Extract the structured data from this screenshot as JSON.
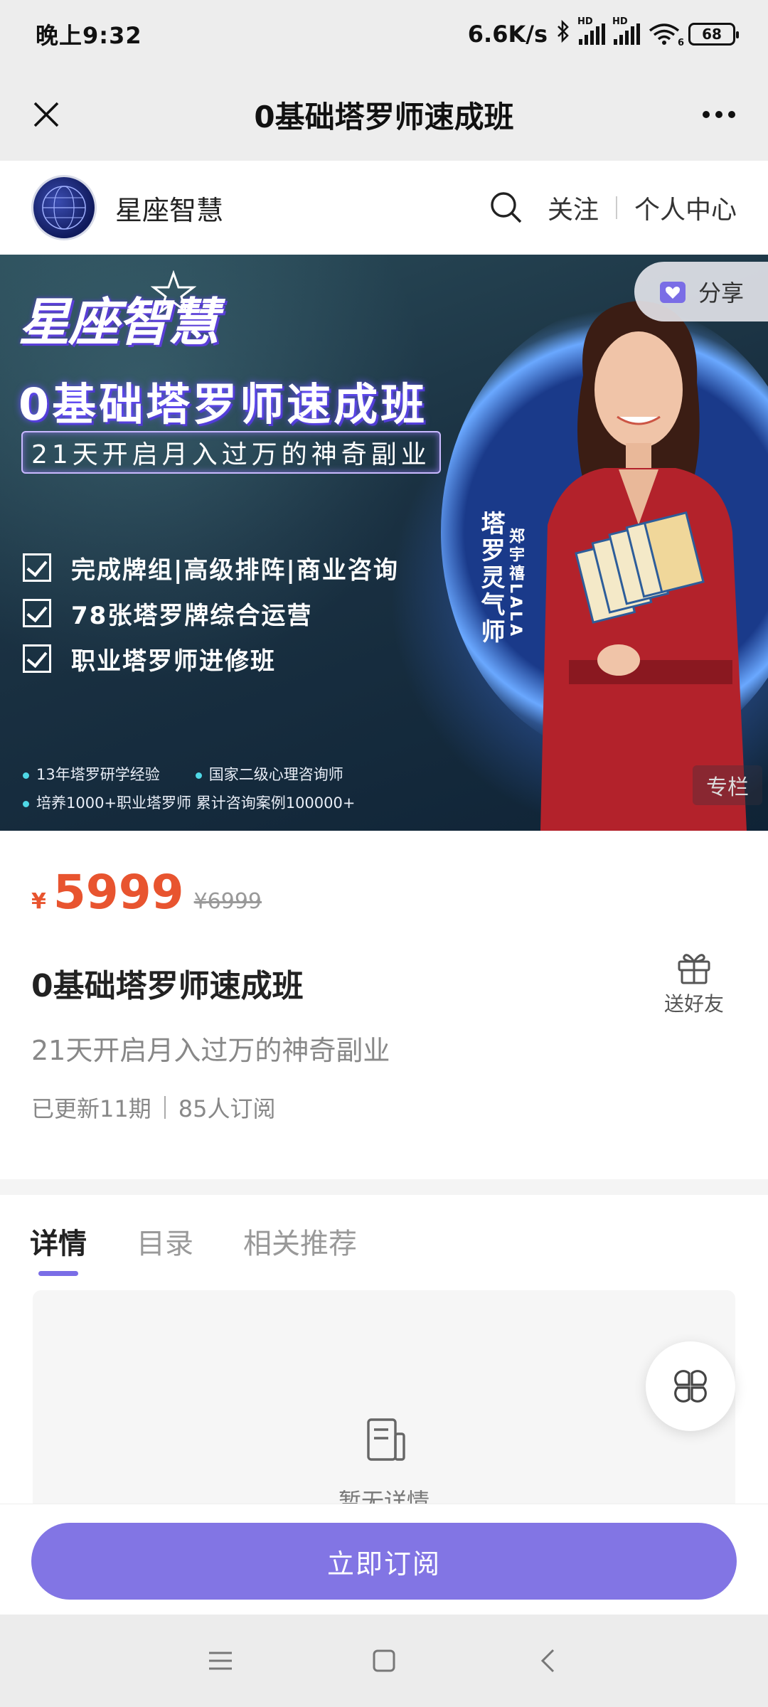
{
  "status_bar": {
    "time": "晚上9:32",
    "net_speed": "6.6K/s",
    "battery": "68",
    "hd1": "HD",
    "hd2": "HD",
    "wifi_badge": "6"
  },
  "nav": {
    "title": "0基础塔罗师速成班"
  },
  "shop": {
    "name": "星座智慧",
    "follow": "关注",
    "personal_center": "个人中心"
  },
  "banner": {
    "logo_text": "星座智慧",
    "title": "0基础塔罗师速成班",
    "subtitle": "21天开启月入过万的神奇副业",
    "checks": [
      "完成牌组|高级排阵|商业咨询",
      "78张塔罗牌综合运营",
      "职业塔罗师进修班"
    ],
    "tags_row1": [
      "13年塔罗研学经验",
      "国家二级心理咨询师"
    ],
    "tags_row2": [
      "培养1000+职业塔罗师 累计咨询案例100000+"
    ],
    "vertical_role": "塔罗灵气师",
    "vertical_name": "郑宇禧LALA",
    "share": "分享",
    "column_tag": "专栏"
  },
  "product": {
    "currency": "¥",
    "price": "5999",
    "original_price": "¥6999",
    "title": "0基础塔罗师速成班",
    "gift_label": "送好友",
    "subtitle": "21天开启月入过万的神奇副业",
    "updated": "已更新11期",
    "subscribers": "85人订阅"
  },
  "tabs": [
    "详情",
    "目录",
    "相关推荐"
  ],
  "detail": {
    "empty_text": "暂无详情"
  },
  "bottom": {
    "subscribe": "立即订阅"
  },
  "colors": {
    "accent": "#8275e4",
    "price": "#e8542f",
    "tab_indicator": "#7a6de6"
  }
}
